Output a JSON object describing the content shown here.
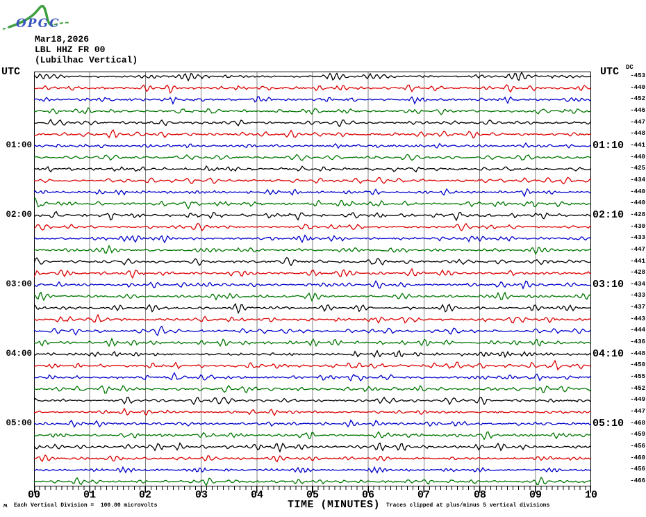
{
  "logo": {
    "text": "OPGC",
    "green": "#3f9e3f",
    "blue": "#3a57c0"
  },
  "header": {
    "date": "Mar18,2026",
    "station": "LBL HHZ FR 00",
    "location": "(Lubilhac Vertical)"
  },
  "titles": {
    "utc_left": "UTC",
    "utc_right": "UTC",
    "dc": "DC"
  },
  "xaxis": {
    "title": "TIME (MINUTES)",
    "tick_labels": [
      "00",
      "01",
      "02",
      "03",
      "04",
      "05",
      "06",
      "07",
      "08",
      "09",
      "10"
    ],
    "minor_ticks_per_major": 10
  },
  "footer": {
    "scale_note": "Each Vertical Division =  100.00 microvolts",
    "clip_note": "Traces clipped at plus/minus 5 vertical divisions",
    "corner_mark": "ʍ"
  },
  "chart_data": {
    "type": "line",
    "subtype": "helicorder-seismogram",
    "title": "LBL HHZ FR 00 (Lubilhac Vertical) Mar18,2026",
    "station": "LBL HHZ FR 00",
    "station_name": "Lubilhac Vertical",
    "date": "Mar18,2026",
    "x_range_minutes": [
      0,
      10
    ],
    "minutes_per_row": 10,
    "rows_per_hour": 6,
    "num_rows": 36,
    "start_time_utc": "00:00",
    "end_time_utc": "06:00",
    "vertical_division_microvolts": 100.0,
    "clip_divisions": 5,
    "grid_color": "#808080",
    "trace_color_cycle": [
      "#000000",
      "#dd0000",
      "#0000cc",
      "#007700"
    ],
    "hour_labels_left": [
      {
        "row": 7,
        "label": "01:00"
      },
      {
        "row": 13,
        "label": "02:00"
      },
      {
        "row": 19,
        "label": "03:00"
      },
      {
        "row": 25,
        "label": "04:00"
      },
      {
        "row": 31,
        "label": "05:00"
      }
    ],
    "hour_labels_right": [
      {
        "row": 7,
        "label": "01:10"
      },
      {
        "row": 13,
        "label": "02:10"
      },
      {
        "row": 19,
        "label": "03:10"
      },
      {
        "row": 25,
        "label": "04:10"
      },
      {
        "row": 31,
        "label": "05:10"
      }
    ],
    "dc_offsets": [
      -453,
      -440,
      -452,
      -446,
      -447,
      -448,
      -441,
      -440,
      -425,
      -434,
      -440,
      -440,
      -428,
      -430,
      -433,
      -447,
      -441,
      -428,
      -434,
      -433,
      -437,
      -443,
      -444,
      -436,
      -448,
      -450,
      -455,
      -452,
      -449,
      -447,
      -468,
      -459,
      -456,
      -460,
      -456,
      -466
    ]
  }
}
